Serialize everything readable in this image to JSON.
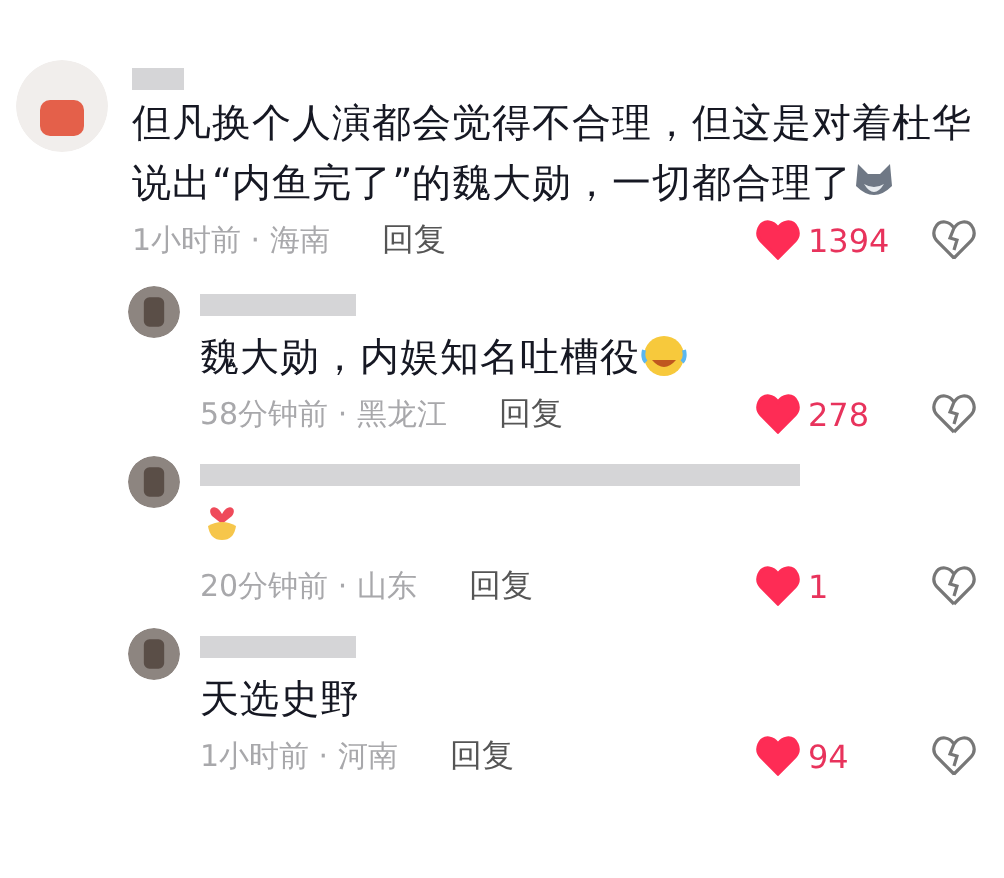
{
  "comments": [
    {
      "text": "但凡换个人演都会觉得不合理，但这是对着杜华说出“内鱼完了”的魏大勋，一切都合理了",
      "icon": {
        "kind": "wolf"
      },
      "time": "1小时前 · 海南",
      "reply": "回复",
      "liked": true,
      "likes": "1394",
      "children": [
        {
          "text": "魏大勋，内娱知名吐槽役",
          "icon": {
            "kind": "laugh"
          },
          "time": "58分钟前 · 黑龙江",
          "reply": "回复",
          "liked": true,
          "likes": "278"
        },
        {
          "icon": {
            "kind": "heart-hands"
          },
          "time": "20分钟前 · 山东",
          "reply": "回复",
          "liked": true,
          "likes": "1"
        },
        {
          "text": "天选史野",
          "time": "1小时前 · 河南",
          "reply": "回复",
          "liked": true,
          "likes": "94"
        }
      ]
    }
  ]
}
